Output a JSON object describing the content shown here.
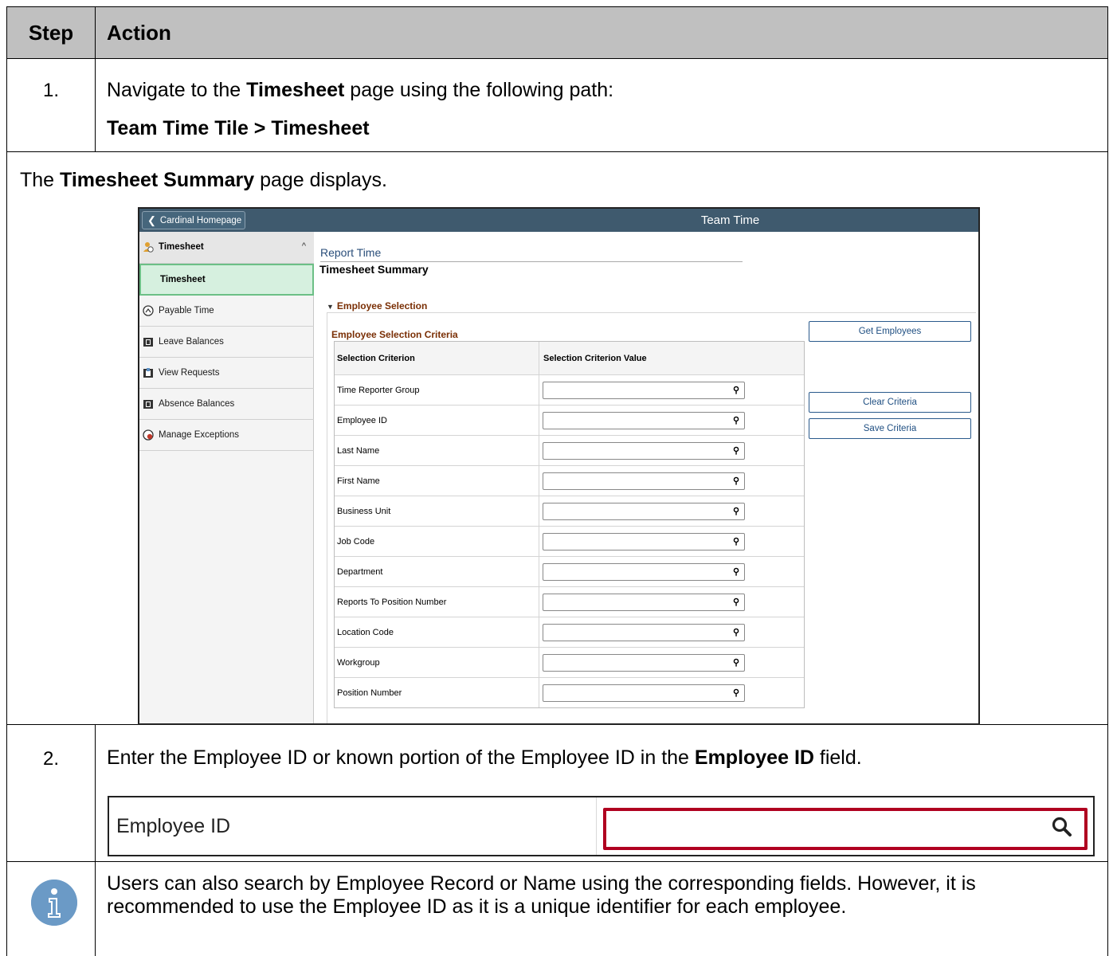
{
  "header": {
    "step": "Step",
    "action": "Action"
  },
  "step1": {
    "number": "1.",
    "line1_prefix": "Navigate to the ",
    "line1_bold": "Timesheet",
    "line1_suffix": " page using the following path:",
    "path": "Team Time Tile > Timesheet"
  },
  "caption": {
    "prefix": "The ",
    "bold": "Timesheet Summary",
    "suffix": " page displays."
  },
  "screenshot": {
    "home_button": "Cardinal Homepage",
    "title": "Team Time",
    "sidebar": {
      "group": "Timesheet",
      "selected": "Timesheet",
      "items": [
        {
          "label": "Payable Time",
          "icon": "clock-icon"
        },
        {
          "label": "Leave Balances",
          "icon": "calendar-icon"
        },
        {
          "label": "View Requests",
          "icon": "calendar-icon"
        },
        {
          "label": "Absence Balances",
          "icon": "calendar-icon"
        },
        {
          "label": "Manage Exceptions",
          "icon": "alert-icon"
        }
      ]
    },
    "report_time": "Report Time",
    "timesheet_summary": "Timesheet Summary",
    "employee_selection": "Employee Selection",
    "criteria_title": "Employee Selection Criteria",
    "col1": "Selection Criterion",
    "col2": "Selection Criterion Value",
    "rows": [
      "Time Reporter Group",
      "Employee ID",
      "Last Name",
      "First Name",
      "Business Unit",
      "Job Code",
      "Department",
      "Reports To Position Number",
      "Location Code",
      "Workgroup",
      "Position Number"
    ],
    "buttons": {
      "get": "Get Employees",
      "clear": "Clear Criteria",
      "save": "Save Criteria"
    }
  },
  "step2": {
    "number": "2.",
    "prefix": "Enter the Employee ID or known portion of the Employee ID in the ",
    "bold": "Employee ID",
    "suffix": " field.",
    "field_label": "Employee ID",
    "highlight_color": "#b00020"
  },
  "note": {
    "icon": "info-icon",
    "text": "Users can also search by Employee Record or Name using the corresponding fields.  However, it is recommended to use the Employee ID as it is a unique identifier for each employee."
  }
}
